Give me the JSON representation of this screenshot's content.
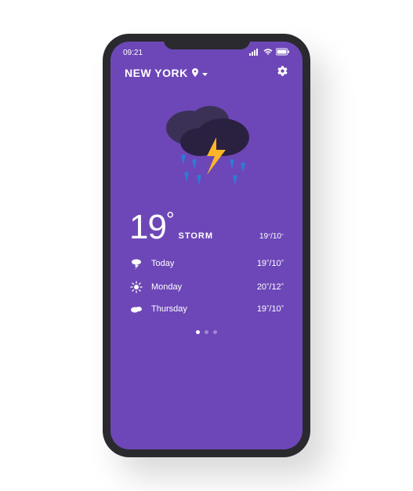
{
  "status": {
    "time": "09:21"
  },
  "header": {
    "location": "NEW YORK"
  },
  "current": {
    "temp": "19",
    "condition": "STORM",
    "high": "19",
    "low": "10"
  },
  "forecast": [
    {
      "day": "Today",
      "high": "19",
      "low": "10",
      "icon": "storm"
    },
    {
      "day": "Monday",
      "high": "20",
      "low": "12",
      "icon": "sunny"
    },
    {
      "day": "Thursday",
      "high": "19",
      "low": "10",
      "icon": "cloudy"
    }
  ],
  "pagination": {
    "count": 3,
    "active": 0
  }
}
